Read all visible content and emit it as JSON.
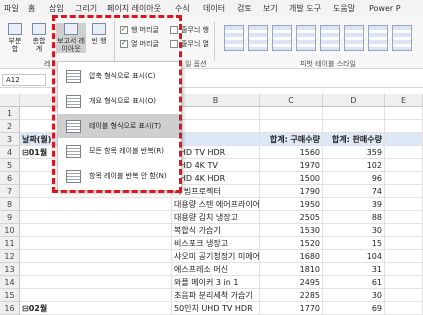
{
  "menu_tabs": [
    "파일",
    "홈",
    "삽입",
    "그리기",
    "페이지 레이아웃",
    "수식",
    "데이터",
    "검토",
    "보기",
    "개발 도구",
    "도움말",
    "Power P"
  ],
  "ribbon": {
    "subtotals": "부분\n합",
    "grandtotals": "총합\n계",
    "report_layout": "보고서 레\n이아웃",
    "blank_rows": "빈 행",
    "row_headers": "행 머리글",
    "banded_rows": "줄무늬 행",
    "column_headers": "열 머리글",
    "banded_columns": "줄무늬 열",
    "group_layout": "레",
    "group_options": "일 옵션",
    "group_styles": "피벗 테이블 스타일",
    "row_headers_checked": true,
    "column_headers_checked": true
  },
  "namebox": "A12",
  "columns": [
    "A",
    "B",
    "C",
    "D",
    "E"
  ],
  "rows": [
    {
      "n": "1",
      "a": "",
      "b": "",
      "c": "",
      "d": ""
    },
    {
      "n": "2",
      "a": "",
      "b": "",
      "c": "",
      "d": ""
    },
    {
      "n": "3",
      "a": "날짜(월)",
      "b": "▾",
      "c": "합계: 구매수량",
      "d": "합계: 판매수량"
    },
    {
      "n": "4",
      "a": "⊟01월",
      "b": "UHD TV HDR",
      "c": "1560",
      "d": "359"
    },
    {
      "n": "5",
      "a": "",
      "b": "UHD 4K TV",
      "c": "1970",
      "d": "102"
    },
    {
      "n": "6",
      "a": "",
      "b": "UHD 4K HDR",
      "c": "1500",
      "d": "96"
    },
    {
      "n": "7",
      "a": "",
      "b": "니 빔프로젝터",
      "c": "1790",
      "d": "74"
    },
    {
      "n": "8",
      "a": "",
      "b": "대용량 스텐 에어프라이어",
      "c": "1950",
      "d": "39"
    },
    {
      "n": "9",
      "a": "",
      "b": "대용량 김치 냉장고",
      "c": "2505",
      "d": "88"
    },
    {
      "n": "10",
      "a": "",
      "b": "복합식 가습기",
      "c": "1530",
      "d": "30"
    },
    {
      "n": "11",
      "a": "",
      "b": "비스포크 냉장고",
      "c": "1520",
      "d": "15"
    },
    {
      "n": "12",
      "a": "",
      "b": "샤오미 공기청정기 미에어",
      "c": "1680",
      "d": "104"
    },
    {
      "n": "13",
      "a": "",
      "b": "에스프레소 머신",
      "c": "1810",
      "d": "31"
    },
    {
      "n": "14",
      "a": "",
      "b": "와플 메이커 3 in 1",
      "c": "2495",
      "d": "61"
    },
    {
      "n": "15",
      "a": "",
      "b": "초음파 분리세척 가습기",
      "c": "2285",
      "d": "30"
    },
    {
      "n": "16",
      "a": "⊟02월",
      "b": "50인치 UHD TV HDR",
      "c": "1770",
      "d": "69"
    }
  ],
  "dropdown": {
    "items": [
      "압축 형식으로 표시(C)",
      "개요 형식으로 표시(O)",
      "테이블 형식으로 표시(T)",
      "모든 항목 레이블 반복(R)",
      "항목 레이블 반복 안 함(N)"
    ],
    "active_index": 2
  },
  "colors": {
    "highlight": "#e0141e",
    "header_fill": "#dde7f5"
  }
}
